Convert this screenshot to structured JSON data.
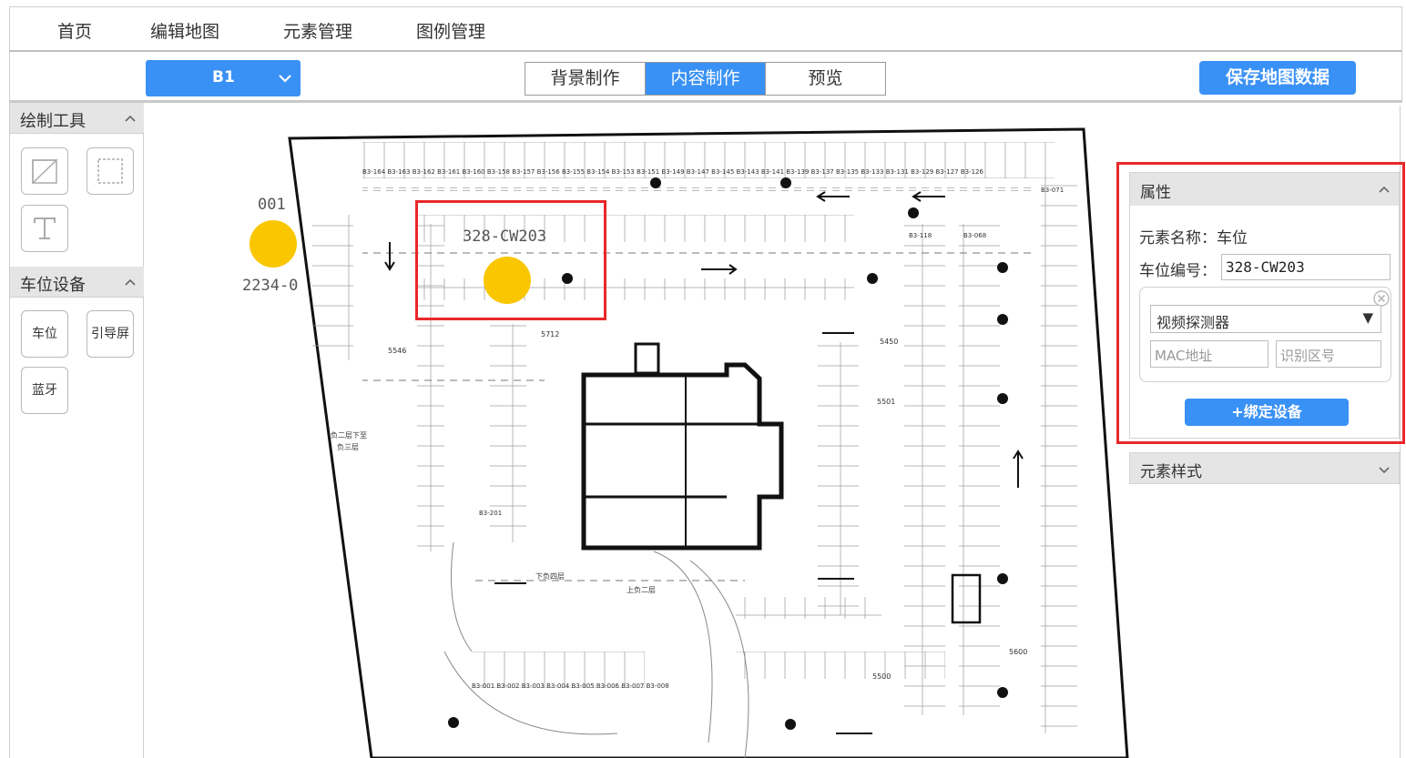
{
  "nav": {
    "items": [
      {
        "label": "首页"
      },
      {
        "label": "编辑地图"
      },
      {
        "label": "元素管理"
      },
      {
        "label": "图例管理"
      }
    ]
  },
  "toolbar": {
    "floor": "B1",
    "modes": [
      {
        "label": "背景制作",
        "active": false
      },
      {
        "label": "内容制作",
        "active": true
      },
      {
        "label": "预览",
        "active": false
      }
    ],
    "save_label": "保存地图数据"
  },
  "sidebar": {
    "draw_tools_title": "绘制工具",
    "draw_tools": [
      "polygon-tool-icon",
      "rectangle-tool-icon",
      "text-tool-icon"
    ],
    "devices_title": "车位设备",
    "devices": [
      {
        "label": "车位"
      },
      {
        "label": "引导屏"
      },
      {
        "label": "蓝牙"
      }
    ]
  },
  "map": {
    "marker1_top_label": "001",
    "marker1_bottom_label": "2234-0",
    "selected_label": "328-CW203",
    "marker_color": "#f9c600",
    "selection_color": "#e8282b"
  },
  "panel": {
    "title": "属性",
    "element_name_label": "元素名称：",
    "element_name_value": "车位",
    "space_no_label": "车位编号：",
    "space_no_value": "328-CW203",
    "device_type": "视频探测器",
    "mac_placeholder": "MAC地址",
    "zone_placeholder": "识别区号",
    "bind_label": "+绑定设备",
    "style_title": "元素样式"
  },
  "colors": {
    "accent": "#3a91f5",
    "header_bg": "#e5e5e5"
  }
}
